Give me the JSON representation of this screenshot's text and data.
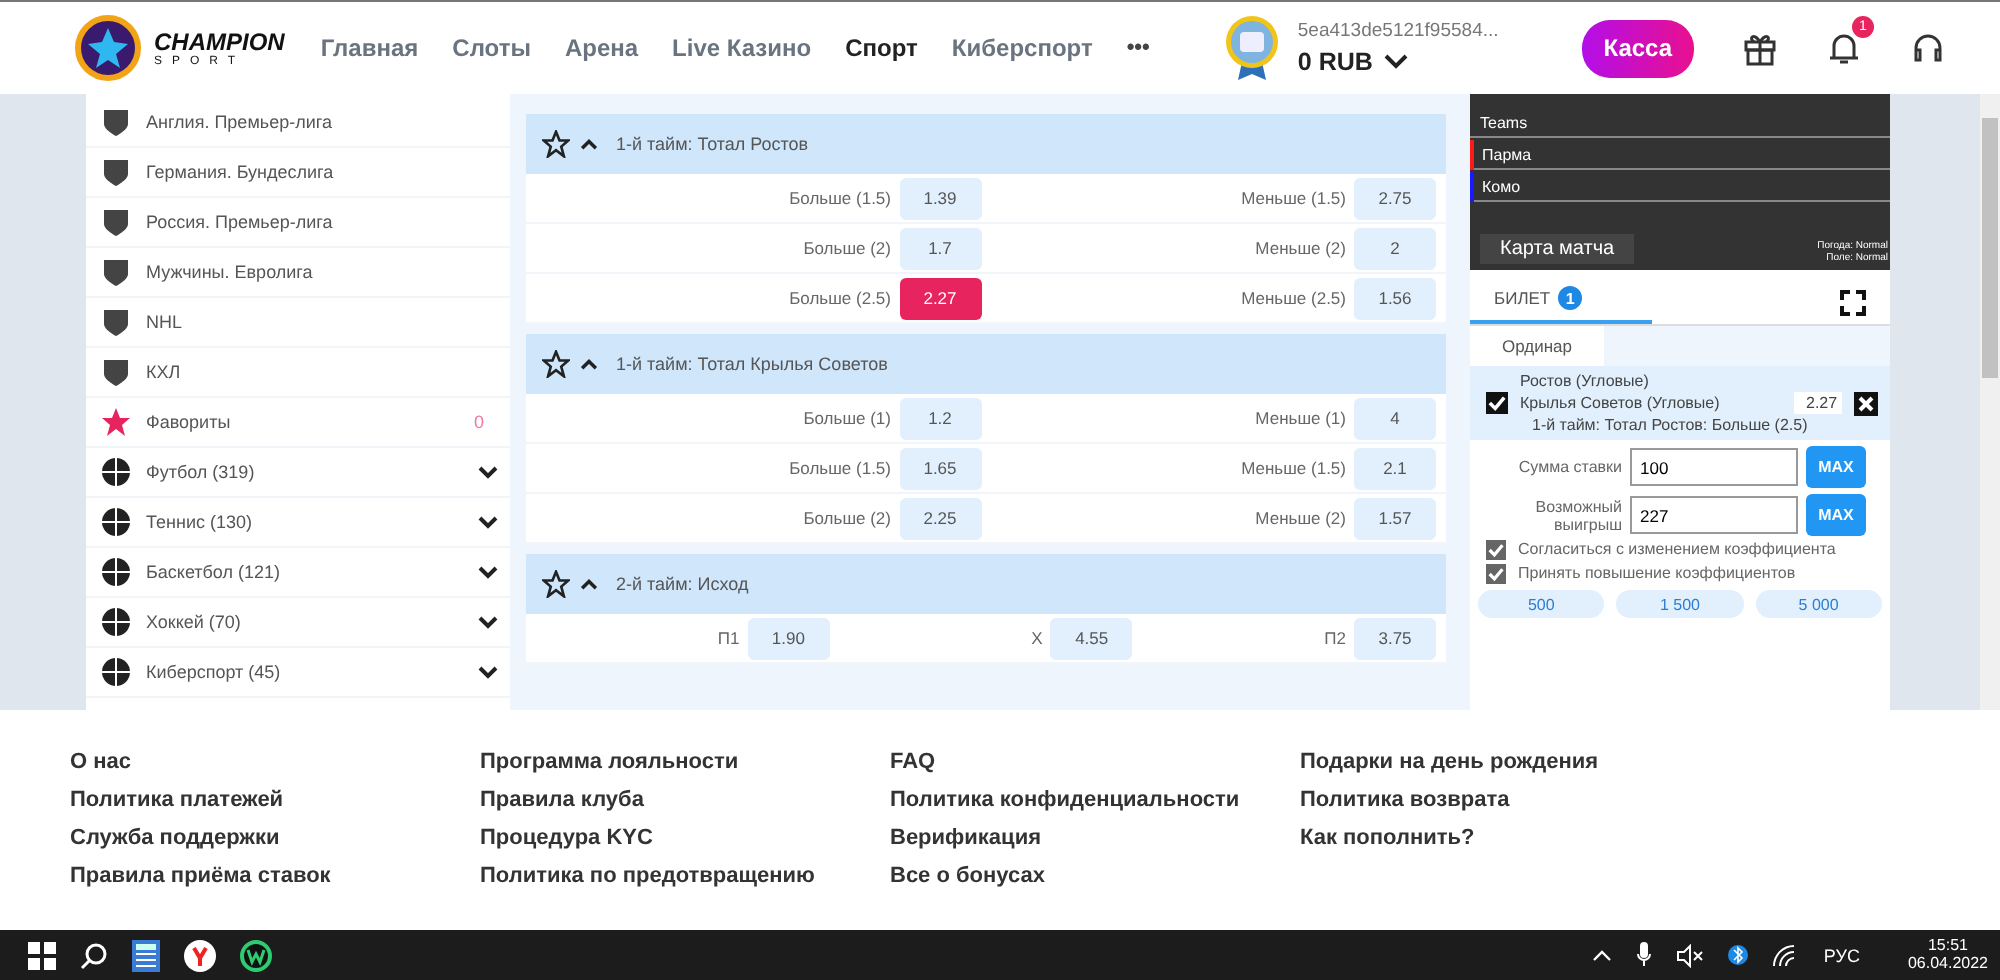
{
  "header": {
    "brand": "CHAMPION",
    "brand_sub": "SPORT",
    "nav": [
      {
        "label": "Главная",
        "selected": false
      },
      {
        "label": "Слоты",
        "selected": false
      },
      {
        "label": "Арена",
        "selected": false
      },
      {
        "label": "Live Казино",
        "selected": false
      },
      {
        "label": "Спорт",
        "selected": true
      },
      {
        "label": "Киберспорт",
        "selected": false
      }
    ],
    "more": "•••",
    "account_id": "5ea413de5121f95584...",
    "balance": "0 RUB",
    "cashier": "Касса",
    "notifications": "1"
  },
  "sidebar": {
    "items": [
      {
        "kind": "league",
        "label": "Англия. Премьер-лига"
      },
      {
        "kind": "league",
        "label": "Германия. Бундеслига"
      },
      {
        "kind": "league",
        "label": "Россия. Премьер-лига"
      },
      {
        "kind": "league",
        "label": "Мужчины. Евролига"
      },
      {
        "kind": "league",
        "label": "NHL"
      },
      {
        "kind": "league",
        "label": "КХЛ"
      },
      {
        "kind": "favorites",
        "label": "Фавориты",
        "count": "0"
      },
      {
        "kind": "sport",
        "label": "Футбол (319)",
        "expanded": false
      },
      {
        "kind": "sport",
        "label": "Теннис (130)",
        "expanded": false
      },
      {
        "kind": "sport",
        "label": "Баскетбол (121)",
        "expanded": false
      },
      {
        "kind": "sport",
        "label": "Хоккей (70)",
        "expanded": false
      },
      {
        "kind": "sport",
        "label": "Киберспорт (45)",
        "expanded": false
      }
    ]
  },
  "markets": [
    {
      "title": "1-й тайм: Тотал Ростов",
      "expanded": true,
      "rows": [
        [
          {
            "label": "Больше (1.5)",
            "odds": "1.39",
            "selected": false
          },
          {
            "label": "Меньше (1.5)",
            "odds": "2.75",
            "selected": false
          }
        ],
        [
          {
            "label": "Больше (2)",
            "odds": "1.7",
            "selected": false
          },
          {
            "label": "Меньше (2)",
            "odds": "2",
            "selected": false
          }
        ],
        [
          {
            "label": "Больше (2.5)",
            "odds": "2.27",
            "selected": true
          },
          {
            "label": "Меньше (2.5)",
            "odds": "1.56",
            "selected": false
          }
        ]
      ]
    },
    {
      "title": "1-й тайм: Тотал Крылья Советов",
      "expanded": true,
      "rows": [
        [
          {
            "label": "Больше (1)",
            "odds": "1.2",
            "selected": false
          },
          {
            "label": "Меньше (1)",
            "odds": "4",
            "selected": false
          }
        ],
        [
          {
            "label": "Больше (1.5)",
            "odds": "1.65",
            "selected": false
          },
          {
            "label": "Меньше (1.5)",
            "odds": "2.1",
            "selected": false
          }
        ],
        [
          {
            "label": "Больше (2)",
            "odds": "2.25",
            "selected": false
          },
          {
            "label": "Меньше (2)",
            "odds": "1.57",
            "selected": false
          }
        ]
      ]
    },
    {
      "title": "2-й тайм: Исход",
      "expanded": true,
      "rows": [
        [
          {
            "label": "П1",
            "odds": "1.90",
            "selected": false
          },
          {
            "label": "X",
            "odds": "4.55",
            "selected": false
          },
          {
            "label": "П2",
            "odds": "3.75",
            "selected": false
          }
        ]
      ]
    }
  ],
  "match_map": {
    "heading": "Teams",
    "teams": [
      {
        "name": "Парма",
        "color": "#ff1a1a"
      },
      {
        "name": "Комо",
        "color": "#1a1aff"
      }
    ],
    "button": "Карта матча",
    "weather": "Погода: Normal",
    "pitch": "Поле: Normal"
  },
  "ticket": {
    "tab": "БИЛЕТ",
    "count": "1",
    "type_tab": "Ординар",
    "bet": {
      "checked": true,
      "team1": "Ростов (Угловые)",
      "team2": "Крылья Советов (Угловые)",
      "odds": "2.27",
      "market": "1-й тайм: Тотал Ростов: Больше (2.5)"
    },
    "stake": {
      "label": "Сумма ставки",
      "value": "100",
      "max": "MAX"
    },
    "win": {
      "label": "Возможный выигрыш",
      "value": "227",
      "max": "MAX"
    },
    "options": [
      {
        "label": "Согласиться с изменением коэффициента",
        "checked": true
      },
      {
        "label": "Принять повышение коэффициентов",
        "checked": true
      }
    ],
    "quick_amounts": [
      "500",
      "1 500",
      "5 000"
    ]
  },
  "footer": {
    "columns": [
      [
        "О нас",
        "Политика платежей",
        "Служба поддержки",
        "Правила приёма ставок"
      ],
      [
        "Программа лояльности",
        "Правила клуба",
        "Процедура KYC",
        "Политика по предотвращению"
      ],
      [
        "FAQ",
        "Политика конфиденциальности",
        "Верификация",
        "Все о бонусах"
      ],
      [
        "Подарки на день рождения",
        "Политика возврата",
        "Как пополнить?"
      ]
    ]
  },
  "taskbar": {
    "language": "РУС",
    "time": "15:51",
    "date": "06.04.2022"
  }
}
